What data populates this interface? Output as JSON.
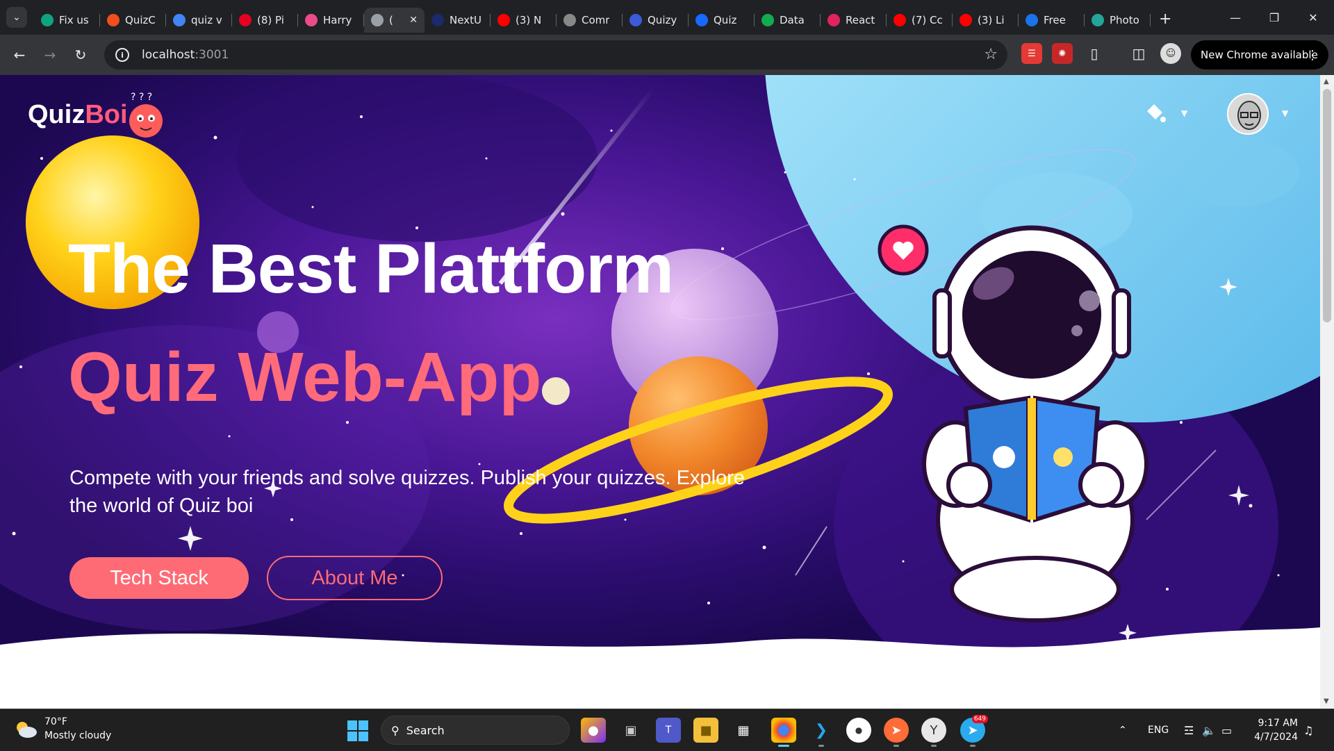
{
  "browser": {
    "tabs": [
      {
        "title": "Fix us",
        "icon": "chatgpt-icon",
        "color": "#10a37f"
      },
      {
        "title": "QuizC",
        "icon": "figma-icon",
        "color": "#f24e1e"
      },
      {
        "title": "quiz v",
        "icon": "google-icon",
        "color": "#4285f4"
      },
      {
        "title": "(8) Pi",
        "icon": "pinterest-icon",
        "color": "#e60023"
      },
      {
        "title": "Harry",
        "icon": "dribbble-icon",
        "color": "#ea4c89"
      },
      {
        "title": "(",
        "icon": "globe-icon",
        "color": "#9aa0a6",
        "active": true
      },
      {
        "title": "NextU",
        "icon": "nextui-icon",
        "color": "#1a2a6c"
      },
      {
        "title": "(3) N",
        "icon": "youtube-icon",
        "color": "#ff0000"
      },
      {
        "title": "Comr",
        "icon": "slash-icon",
        "color": "#888888"
      },
      {
        "title": "Quizy",
        "icon": "quizy-icon",
        "color": "#3b5bdb"
      },
      {
        "title": "Quiz",
        "icon": "behance-icon",
        "color": "#1769ff"
      },
      {
        "title": "Data",
        "icon": "mongodb-icon",
        "color": "#13aa52"
      },
      {
        "title": "React",
        "icon": "react-icon",
        "color": "#e0245e"
      },
      {
        "title": "(7) Cc",
        "icon": "youtube-icon",
        "color": "#ff0000"
      },
      {
        "title": "(3) Li",
        "icon": "youtube-icon",
        "color": "#ff0000"
      },
      {
        "title": "Free",
        "icon": "forms-icon",
        "color": "#1a73e8"
      },
      {
        "title": "Photo",
        "icon": "photo-icon",
        "color": "#22a699"
      }
    ],
    "url_host": "localhost",
    "url_port": ":3001",
    "update_label": "New Chrome available"
  },
  "page": {
    "logo_quiz": "Quiz",
    "logo_boi": "Boi",
    "headline": "The Best Plattform",
    "subhead": "Quiz Web-App",
    "description": "Compete with your friends and solve quizzes. Publish your quizzes. Explore the world of Quiz boi",
    "btn_primary": "Tech Stack",
    "btn_secondary": "About Me",
    "accent": "#ff6b75"
  },
  "taskbar": {
    "weather_temp": "70°F",
    "weather_desc": "Mostly cloudy",
    "search_label": "Search",
    "lang": "ENG",
    "time": "9:17 AM",
    "date": "4/7/2024",
    "telegram_badge": "649"
  }
}
